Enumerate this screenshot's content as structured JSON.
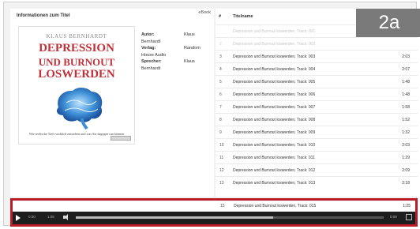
{
  "info_panel": {
    "title": "Informationen zum Titel",
    "ebook_label": "eBook",
    "cover": {
      "author": "KLAUS BERNHARDT",
      "line1": "DEPRESSION",
      "line2": "UND BURNOUT",
      "line3": "LOSWERDEN",
      "subtitle": "Wie seelische Tiefs wirklich entstehen und was Sie dagegen tun können"
    },
    "metadata": [
      {
        "key": "Autor:",
        "value": "Klaus",
        "cont": "Bernhardt"
      },
      {
        "key": "Verlag:",
        "value": "Random",
        "cont": "House Audio"
      },
      {
        "key": "Sprecher:",
        "value": "Klaus",
        "cont": "Bernhardt"
      }
    ]
  },
  "track_list": {
    "col_num": "#",
    "col_name": "Titelname",
    "rows": [
      {
        "n": "",
        "title": "Depression und Burnout loswerden, Track: 001",
        "duration": "",
        "faded": true
      },
      {
        "n": "2",
        "title": "Depression und Burnout loswerden, Track: 002",
        "duration": "",
        "faded": true
      },
      {
        "n": "3",
        "title": "Depression und Burnout loswerden, Track: 003",
        "duration": "2:03",
        "faded": false
      },
      {
        "n": "4",
        "title": "Depression und Burnout loswerden, Track: 004",
        "duration": "2:07",
        "faded": false
      },
      {
        "n": "5",
        "title": "Depression und Burnout loswerden, Track: 005",
        "duration": "1:48",
        "faded": false
      },
      {
        "n": "6",
        "title": "Depression und Burnout loswerden, Track: 006",
        "duration": "1:48",
        "faded": false
      },
      {
        "n": "7",
        "title": "Depression und Burnout loswerden, Track: 007",
        "duration": "1:58",
        "faded": false
      },
      {
        "n": "8",
        "title": "Depression und Burnout loswerden, Track: 008",
        "duration": "1:52",
        "faded": false
      },
      {
        "n": "9",
        "title": "Depression und Burnout loswerden, Track: 009",
        "duration": "1:32",
        "faded": false
      },
      {
        "n": "10",
        "title": "Depression und Burnout loswerden, Track: 010",
        "duration": "2:03",
        "faded": false
      },
      {
        "n": "11",
        "title": "Depression und Burnout loswerden, Track: 011",
        "duration": "1:29",
        "faded": false
      },
      {
        "n": "12",
        "title": "Depression und Burnout loswerden, Track: 012",
        "duration": "2:09",
        "faded": false
      },
      {
        "n": "13",
        "title": "Depression und Burnout loswerden, Track: 013",
        "duration": "2:18",
        "faded": false
      }
    ],
    "bottom_row": {
      "n": "15",
      "title": "Depression und Burnout loswerden, Track: 015",
      "duration": "1:25"
    }
  },
  "step_badge": "2a",
  "player": {
    "elapsed": "0:00",
    "length": "1:05",
    "end_time": "0:08",
    "progress": 0.64,
    "accent_color": "#b91c24"
  }
}
